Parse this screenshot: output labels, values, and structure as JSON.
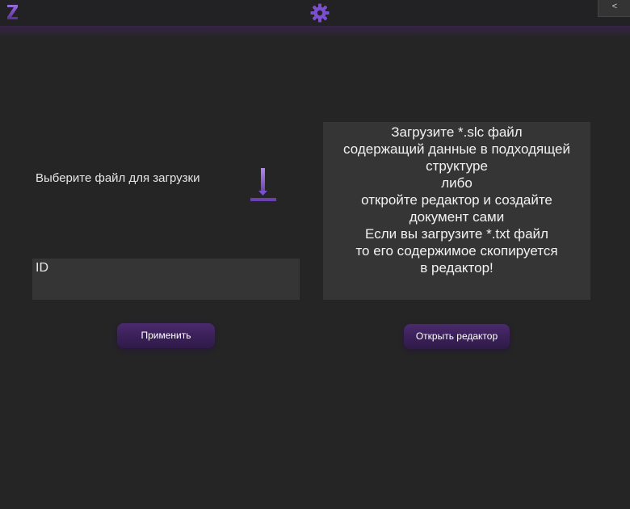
{
  "header": {
    "logo_icon": "z-logo-icon",
    "settings_icon": "gear-icon",
    "back_label": "<"
  },
  "upload": {
    "choose_label": "Выберите файл для загрузки",
    "upload_icon": "download-arrow-icon",
    "id_placeholder": "ID",
    "apply_label": "Применить"
  },
  "info": {
    "lines": [
      "Загрузите *.slc файл",
      "содержащий данные в подходящей",
      "структуре",
      "либо",
      "откройте редактор и создайте",
      "документ сами",
      "Если вы загрузите *.txt файл",
      "то его содержимое скопируется",
      "в редактор!"
    ],
    "editor_label": "Открыть редактор"
  },
  "colors": {
    "background": "#252526",
    "panel": "#353535",
    "accent": "#6a3fb0",
    "button": "#3a2057"
  }
}
